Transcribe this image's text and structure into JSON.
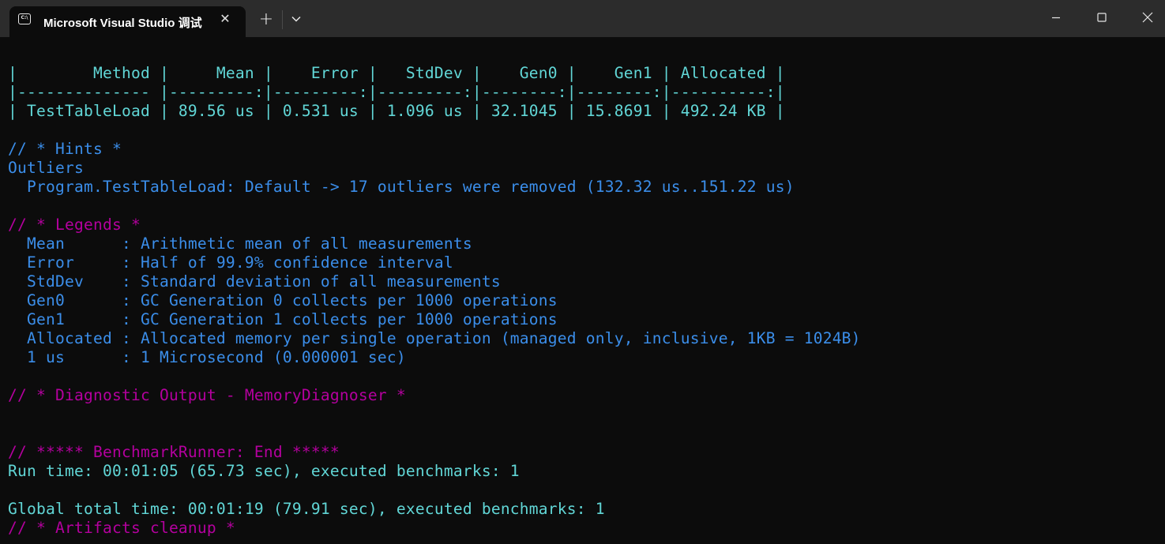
{
  "window": {
    "tab_title": "Microsoft Visual Studio 调试",
    "tab_icon": "console-icon",
    "close_tab_glyph": "✕",
    "new_tab_glyph": "+",
    "controls": [
      "minimize",
      "maximize",
      "close"
    ]
  },
  "colors": {
    "background": "#0c0c0c",
    "titlebar": "#2c2c2c",
    "cyan": "#61d6d6",
    "blue": "#3b8eea",
    "magenta": "#b4009e"
  },
  "summary_table": {
    "header_line": "|        Method |     Mean |    Error |   StdDev |    Gen0 |    Gen1 | Allocated |",
    "separator_line": "|-------------- |---------:|---------:|---------:|--------:|--------:|----------:|",
    "row_line": "| TestTableLoad | 89.56 us | 0.531 us | 1.096 us | 32.1045 | 15.8691 | 492.24 KB |",
    "columns": [
      "Method",
      "Mean",
      "Error",
      "StdDev",
      "Gen0",
      "Gen1",
      "Allocated"
    ],
    "rows": [
      [
        "TestTableLoad",
        "89.56 us",
        "0.531 us",
        "1.096 us",
        "32.1045",
        "15.8691",
        "492.24 KB"
      ]
    ]
  },
  "hints": {
    "heading": "// * Hints *",
    "title": "Outliers",
    "detail": "  Program.TestTableLoad: Default -> 17 outliers were removed (132.32 us..151.22 us)"
  },
  "legends": {
    "heading": "// * Legends *",
    "items": [
      "  Mean      : Arithmetic mean of all measurements",
      "  Error     : Half of 99.9% confidence interval",
      "  StdDev    : Standard deviation of all measurements",
      "  Gen0      : GC Generation 0 collects per 1000 operations",
      "  Gen1      : GC Generation 1 collects per 1000 operations",
      "  Allocated : Allocated memory per single operation (managed only, inclusive, 1KB = 1024B)",
      "  1 us      : 1 Microsecond (0.000001 sec)"
    ]
  },
  "diagnostic": {
    "heading": "// * Diagnostic Output - MemoryDiagnoser *"
  },
  "runner_end": {
    "heading": "// ***** BenchmarkRunner: End *****",
    "run_time": "Run time: 00:01:05 (65.73 sec), executed benchmarks: 1",
    "global_time": "Global total time: 00:01:19 (79.91 sec), executed benchmarks: 1",
    "cleanup": "// * Artifacts cleanup *"
  }
}
